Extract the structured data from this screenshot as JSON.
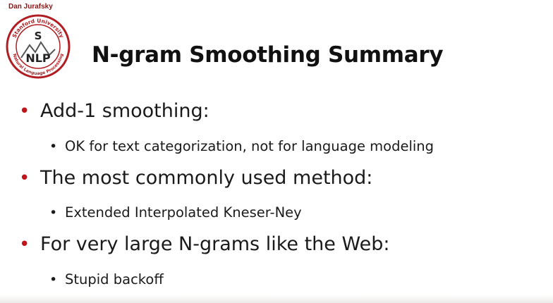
{
  "header": {
    "author": "Dan Jurafsky",
    "logo": {
      "letter_top": "S",
      "letters_bottom": "NLP",
      "ring_text_top": "Stanford University",
      "ring_text_bottom": "Natural Language Processing",
      "color": "#b01e23"
    }
  },
  "slide": {
    "title": "N-gram Smoothing Summary",
    "bullet_color": "#c0141a",
    "items": [
      {
        "text": "Add-1 smoothing:",
        "sub": "OK for text categorization, not for language modeling"
      },
      {
        "text": "The most commonly used method:",
        "sub": "Extended Interpolated Kneser-Ney"
      },
      {
        "text": "For very large N-grams like the Web:",
        "sub": "Stupid backoff"
      }
    ]
  }
}
